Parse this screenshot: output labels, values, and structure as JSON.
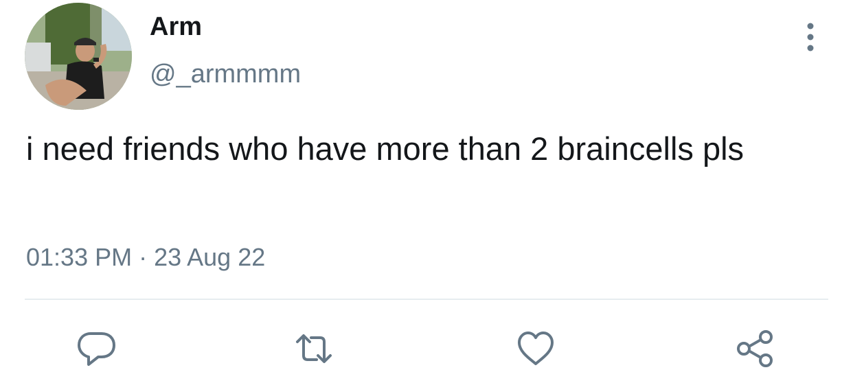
{
  "user": {
    "display_name": "Arm",
    "handle": "@_armmmm",
    "avatar_icon": "profile-photo"
  },
  "tweet": {
    "text": "i need friends who have more than 2 braincells pls",
    "time": "01:33 PM",
    "separator": "·",
    "date": "23 Aug 22"
  },
  "actions": {
    "more_icon": "more-vertical-icon",
    "reply_icon": "reply-icon",
    "retweet_icon": "retweet-icon",
    "like_icon": "heart-icon",
    "share_icon": "share-icon"
  },
  "colors": {
    "text": "#14171a",
    "secondary": "#657786",
    "icon": "#657786",
    "divider": "#e6ecf0"
  }
}
